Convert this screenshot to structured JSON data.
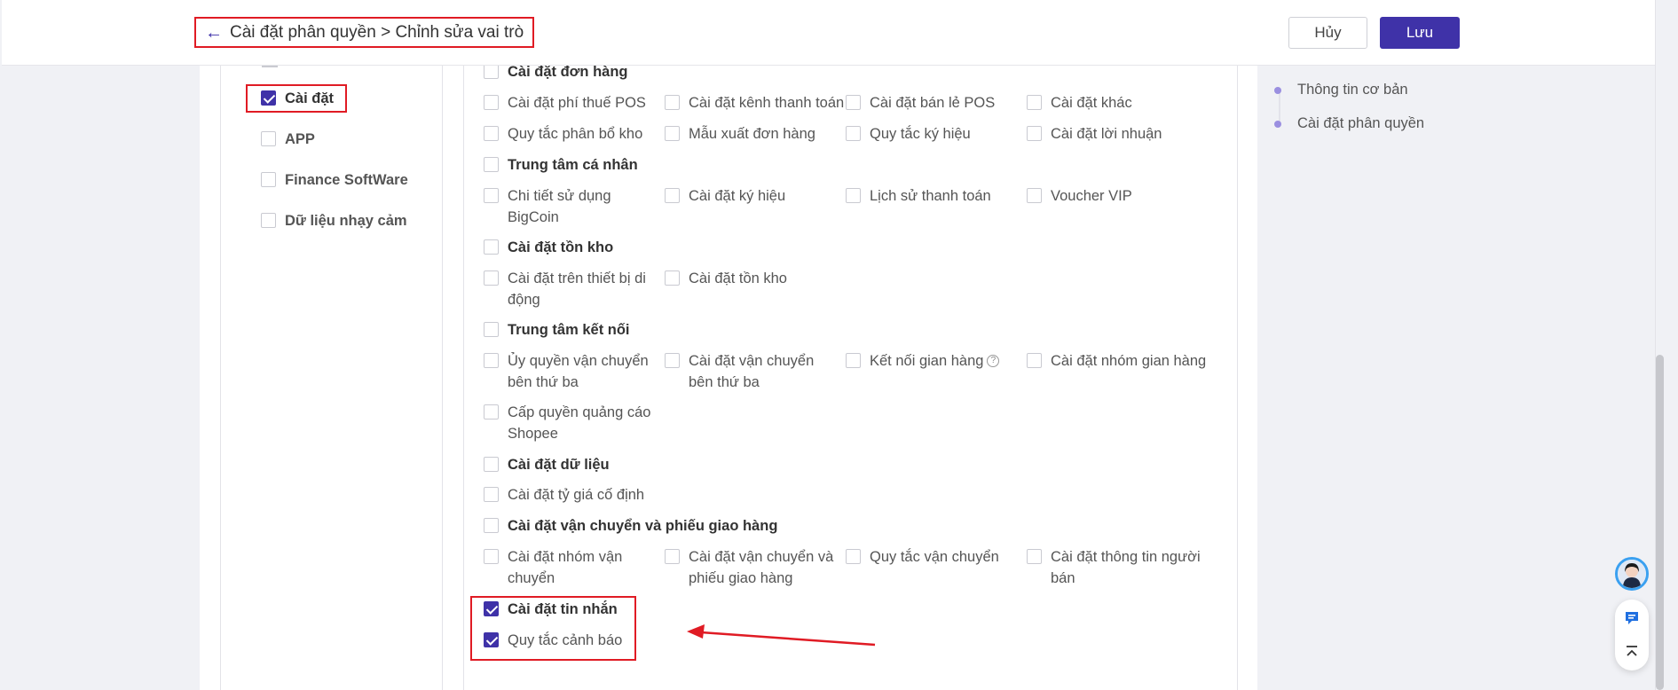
{
  "header": {
    "breadcrumb": "Cài đặt phân quyền > Chỉnh sửa vai trò",
    "cancel_label": "Hủy",
    "save_label": "Lưu"
  },
  "left_menu": [
    {
      "label": "Cài đặt",
      "checked": true
    },
    {
      "label": "APP",
      "checked": false
    },
    {
      "label": "Finance SoftWare",
      "checked": false
    },
    {
      "label": "Dữ liệu nhạy cảm",
      "checked": false
    }
  ],
  "permissions": {
    "order_settings": {
      "title": "Cài đặt đơn hàng",
      "items": [
        "Cài đặt phí thuế POS",
        "Cài đặt kênh thanh toán",
        "Cài đặt bán lẻ POS",
        "Cài đặt khác",
        "Quy tắc phân bổ kho",
        "Mẫu xuất đơn hàng",
        "Quy tắc ký hiệu",
        "Cài đặt lời nhuận"
      ]
    },
    "personal_center": {
      "title": "Trung tâm cá nhân",
      "items": [
        "Chi tiết sử dụng BigCoin",
        "Cài đặt ký hiệu",
        "Lịch sử thanh toán",
        "Voucher VIP"
      ]
    },
    "inventory_settings": {
      "title": "Cài đặt tồn kho",
      "items": [
        "Cài đặt trên thiết bị di động",
        "Cài đặt tồn kho"
      ]
    },
    "connection_center": {
      "title": "Trung tâm kết nối",
      "items": [
        "Ủy quyền vận chuyển bên thứ ba",
        "Cài đặt vận chuyển bên thứ ba",
        "Kết nối gian hàng",
        "Cài đặt nhóm gian hàng",
        "Cấp quyền quảng cáo Shopee"
      ]
    },
    "data_settings": {
      "title": "Cài đặt dữ liệu",
      "items": [
        "Cài đặt tỷ giá cố định"
      ]
    },
    "shipping_settings": {
      "title": "Cài đặt vận chuyển và phiếu giao hàng",
      "items": [
        "Cài đặt nhóm vận chuyển",
        "Cài đặt vận chuyển và phiếu giao hàng",
        "Quy tắc vận chuyển",
        "Cài đặt thông tin người bán"
      ]
    },
    "message_settings": {
      "title": "Cài đặt tin nhắn",
      "checked": true,
      "items": [
        "Quy tắc cảnh báo"
      ],
      "items_checked": [
        true
      ]
    }
  },
  "outline": [
    "Thông tin cơ bản",
    "Cài đặt phân quyền"
  ],
  "icons": {
    "back": "arrow-left-icon",
    "help": "question-circle-icon",
    "chat": "chat-icon",
    "top": "back-to-top-icon"
  },
  "colors": {
    "primary": "#3f32a8",
    "highlight": "#e01b24"
  }
}
